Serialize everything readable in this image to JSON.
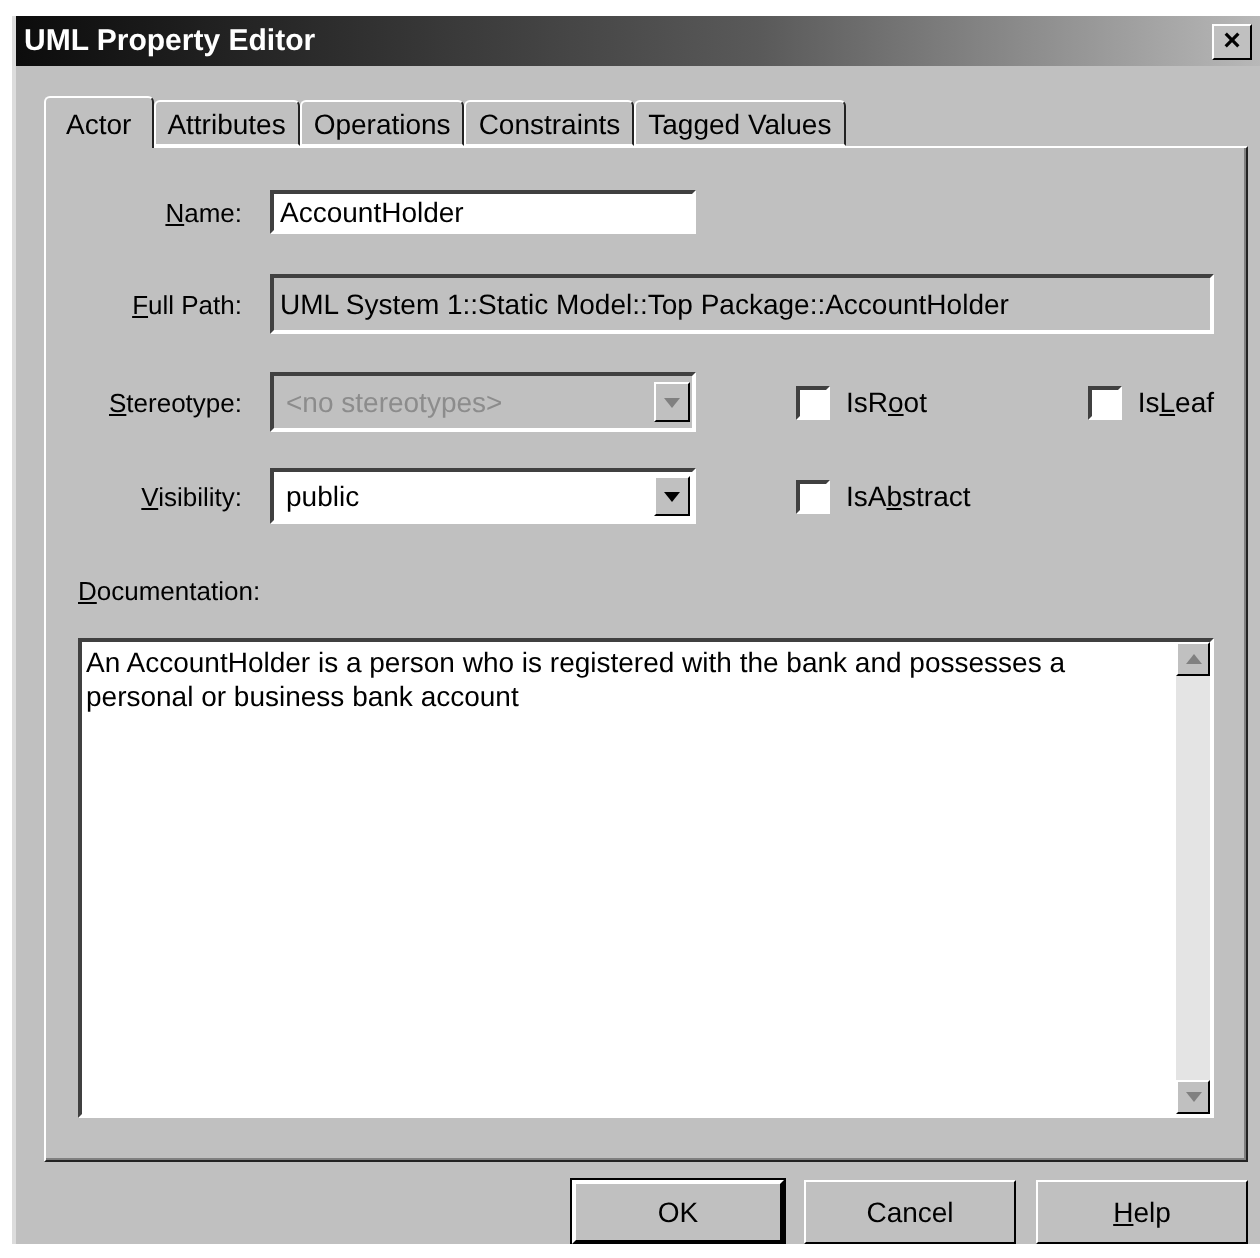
{
  "window": {
    "title": "UML Property Editor",
    "close": "×"
  },
  "tabs": [
    {
      "label": "Actor",
      "selected": true
    },
    {
      "label": "Attributes",
      "selected": false
    },
    {
      "label": "Operations",
      "selected": false
    },
    {
      "label": "Constraints",
      "selected": false
    },
    {
      "label": "Tagged Values",
      "selected": false
    }
  ],
  "name": {
    "label": {
      "key": "N",
      "after": "ame:"
    },
    "value": "AccountHolder"
  },
  "full_path": {
    "label": {
      "key": "F",
      "after": "ull Path:"
    },
    "value": "UML System 1::Static Model::Top Package::AccountHolder"
  },
  "stereotype": {
    "label": {
      "key": "S",
      "after": "tereotype:"
    },
    "value": "<no stereotypes>",
    "disabled": true
  },
  "visibility": {
    "label": {
      "key": "V",
      "after": "isibility:"
    },
    "value": "public",
    "disabled": false
  },
  "checkboxes": [
    {
      "label": {
        "before": "IsR",
        "key": "o",
        "after": "ot"
      },
      "checked": false
    },
    {
      "label": {
        "before": "Is",
        "key": "L",
        "after": "eaf"
      },
      "checked": false
    },
    {
      "label": {
        "before": "IsA",
        "key": "b",
        "after": "stract"
      },
      "checked": false
    }
  ],
  "documentation": {
    "label": {
      "key": "D",
      "after": "ocumentation:"
    },
    "value": "An AccountHolder is a person who is registered with the bank and possesses a personal or business bank account"
  },
  "buttons": [
    {
      "label": {
        "before": "OK"
      },
      "default": true
    },
    {
      "label": {
        "before": "Cancel"
      },
      "default": false
    },
    {
      "label": {
        "key": "H",
        "after": "elp"
      },
      "default": false
    }
  ]
}
